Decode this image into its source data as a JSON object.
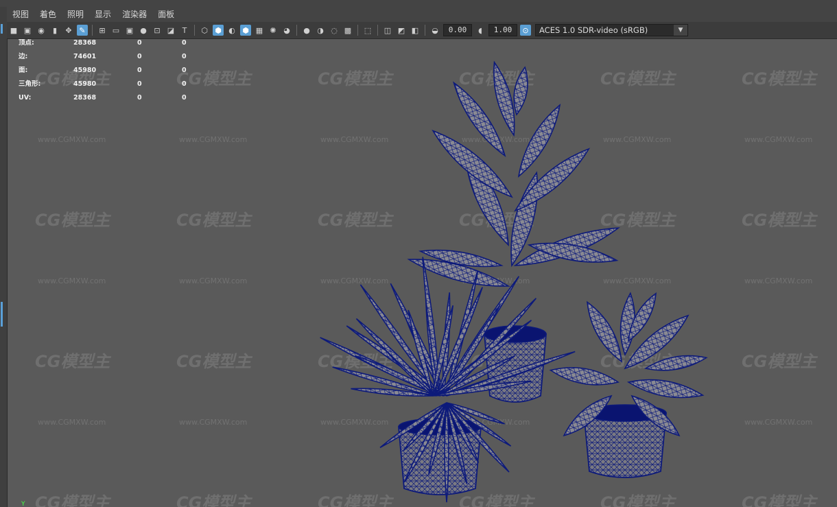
{
  "menu": {
    "items": [
      "视图",
      "着色",
      "照明",
      "显示",
      "渲染器",
      "面板"
    ]
  },
  "toolbar": {
    "exposure_value": "0.00",
    "gamma_value": "1.00",
    "color_management": "ACES 1.0 SDR-video (sRGB)"
  },
  "hud": {
    "rows": [
      {
        "label": "顶点:",
        "v1": "28368",
        "v2": "0",
        "v3": "0"
      },
      {
        "label": "边:",
        "v1": "74601",
        "v2": "0",
        "v3": "0"
      },
      {
        "label": "面:",
        "v1": "45980",
        "v2": "0",
        "v3": "0"
      },
      {
        "label": "三角形:",
        "v1": "45980",
        "v2": "0",
        "v3": "0"
      },
      {
        "label": "UV:",
        "v1": "28368",
        "v2": "0",
        "v3": "0"
      }
    ]
  },
  "watermark": {
    "logo": "CG模型主",
    "url": "www.CGMXW.com"
  },
  "colors": {
    "viewport_bg": "#5a5a5a",
    "wire": "#0d1a7a",
    "accent": "#5b9fd4"
  },
  "scene": {
    "axis_label": "Y"
  }
}
